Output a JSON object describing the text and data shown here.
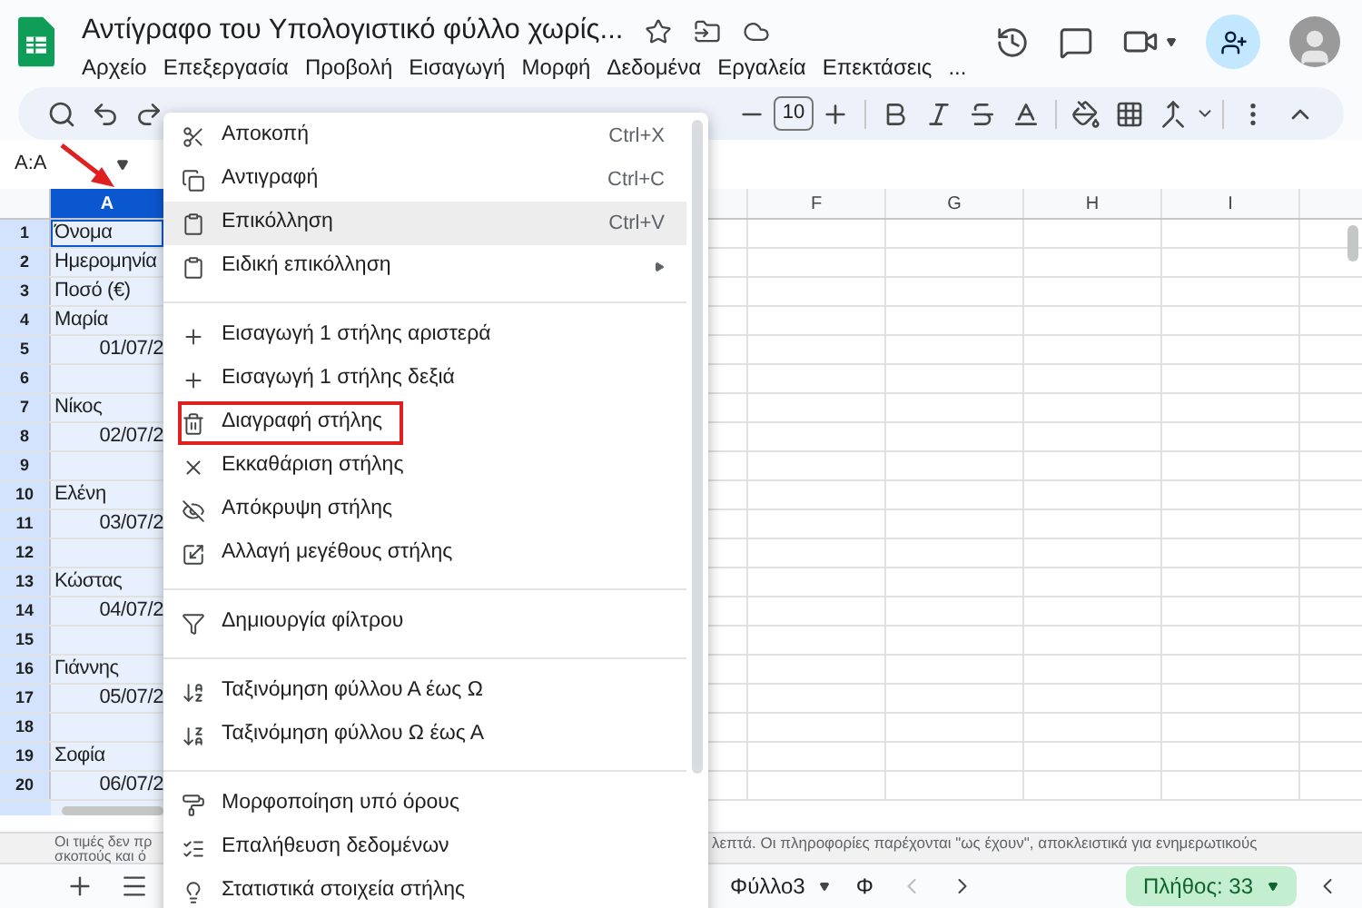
{
  "title": "Αντίγραφο του Υπολογιστικό φύλλο χωρίς...",
  "menubar": [
    "Αρχείο",
    "Επεξεργασία",
    "Προβολή",
    "Εισαγωγή",
    "Μορφή",
    "Δεδομένα",
    "Εργαλεία",
    "Επεκτάσεις",
    "..."
  ],
  "font_size": "10",
  "name_box": "A:A",
  "columns": [
    {
      "label": "A",
      "selected": true
    },
    {
      "label": "F",
      "selected": false
    },
    {
      "label": "G",
      "selected": false
    },
    {
      "label": "H",
      "selected": false
    },
    {
      "label": "I",
      "selected": false
    }
  ],
  "rows": [
    {
      "number": "1",
      "value": "Όνομα",
      "kind": "text"
    },
    {
      "number": "2",
      "value": "Ημερομηνία",
      "kind": "text"
    },
    {
      "number": "3",
      "value": "Ποσό (€)",
      "kind": "text"
    },
    {
      "number": "4",
      "value": "Μαρία",
      "kind": "text"
    },
    {
      "number": "5",
      "value": "01/07/2",
      "kind": "date"
    },
    {
      "number": "6"
    },
    {
      "number": "7",
      "value": "Νίκος",
      "kind": "text"
    },
    {
      "number": "8",
      "value": "02/07/2",
      "kind": "date"
    },
    {
      "number": "9"
    },
    {
      "number": "10",
      "value": "Ελένη",
      "kind": "text"
    },
    {
      "number": "11",
      "value": "03/07/2",
      "kind": "date"
    },
    {
      "number": "12"
    },
    {
      "number": "13",
      "value": "Κώστας",
      "kind": "text"
    },
    {
      "number": "14",
      "value": "04/07/2",
      "kind": "date"
    },
    {
      "number": "15"
    },
    {
      "number": "16",
      "value": "Γιάννης",
      "kind": "text"
    },
    {
      "number": "17",
      "value": "05/07/2",
      "kind": "date"
    },
    {
      "number": "18"
    },
    {
      "number": "19",
      "value": "Σοφία",
      "kind": "text"
    },
    {
      "number": "20",
      "value": "06/07/2",
      "kind": "date"
    }
  ],
  "context_menu": [
    {
      "kind": "item",
      "label": "Αποκοπή",
      "shortcut": "Ctrl+X",
      "submenu": false,
      "highlighted": false,
      "outlined": false
    },
    {
      "kind": "item",
      "label": "Αντιγραφή",
      "shortcut": "Ctrl+C",
      "submenu": false,
      "highlighted": false,
      "outlined": false
    },
    {
      "kind": "item",
      "label": "Επικόλληση",
      "shortcut": "Ctrl+V",
      "submenu": false,
      "highlighted": true,
      "outlined": false
    },
    {
      "kind": "item",
      "label": "Ειδική επικόλληση",
      "submenu": true,
      "highlighted": false,
      "outlined": false
    },
    {
      "kind": "separator"
    },
    {
      "kind": "item",
      "label": "Εισαγωγή 1 στήλης αριστερά",
      "submenu": false,
      "highlighted": false,
      "outlined": false
    },
    {
      "kind": "item",
      "label": "Εισαγωγή 1 στήλης δεξιά",
      "submenu": false,
      "highlighted": false,
      "outlined": false
    },
    {
      "kind": "item",
      "label": "Διαγραφή στήλης",
      "submenu": false,
      "highlighted": false,
      "outlined": true
    },
    {
      "kind": "item",
      "label": "Εκκαθάριση στήλης",
      "submenu": false,
      "highlighted": false,
      "outlined": false
    },
    {
      "kind": "item",
      "label": "Απόκρυψη στήλης",
      "submenu": false,
      "highlighted": false,
      "outlined": false
    },
    {
      "kind": "item",
      "label": "Αλλαγή μεγέθους στήλης",
      "submenu": false,
      "highlighted": false,
      "outlined": false
    },
    {
      "kind": "separator"
    },
    {
      "kind": "item",
      "label": "Δημιουργία φίλτρου",
      "submenu": false,
      "highlighted": false,
      "outlined": false
    },
    {
      "kind": "separator"
    },
    {
      "kind": "item",
      "label": "Ταξινόμηση φύλλου Α έως Ω",
      "submenu": false,
      "highlighted": false,
      "outlined": false
    },
    {
      "kind": "item",
      "label": "Ταξινόμηση φύλλου Ω έως Α",
      "submenu": false,
      "highlighted": false,
      "outlined": false
    },
    {
      "kind": "separator"
    },
    {
      "kind": "item",
      "label": "Μορφοποίηση υπό όρους",
      "submenu": false,
      "highlighted": false,
      "outlined": false
    },
    {
      "kind": "item",
      "label": "Επαλήθευση δεδομένων",
      "submenu": false,
      "highlighted": false,
      "outlined": false
    },
    {
      "kind": "item",
      "label": "Στατιστικά στοιχεία στήλης",
      "submenu": false,
      "highlighted": false,
      "outlined": false
    }
  ],
  "notice": {
    "left_lines": [
      "Οι τιμές δεν πρ",
      "σκοπούς και ό"
    ],
    "right_text": "λεπτά. Οι πληροφορίες παρέχονται \"ως έχουν\", αποκλειστικά για ενημερωτικούς"
  },
  "sheet_tabs": [
    {
      "label": "Φύλλο3",
      "selected": false
    },
    {
      "label": "Φ",
      "selected": false
    }
  ],
  "summary": "Πλήθος: 33"
}
